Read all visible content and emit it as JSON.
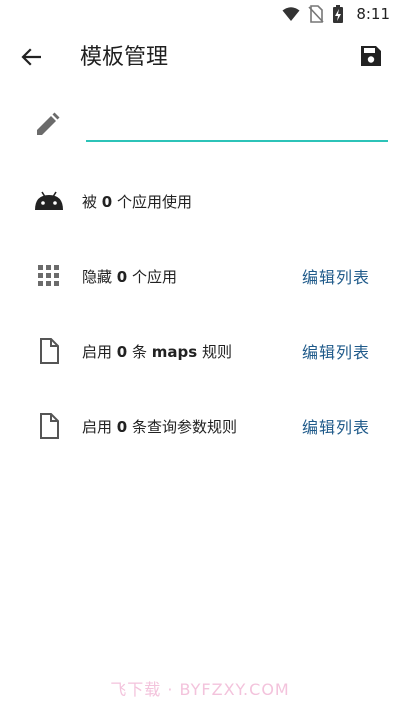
{
  "status_bar": {
    "time": "8:11",
    "icons": [
      "wifi-icon",
      "no-sim-icon",
      "battery-charging-icon"
    ]
  },
  "app_bar": {
    "title": "模板管理",
    "back_icon": "arrow-back-icon",
    "save_icon": "save-icon"
  },
  "name_field": {
    "value": "",
    "placeholder": "",
    "icon": "pencil-icon"
  },
  "rows": [
    {
      "icon": "android-icon",
      "prefix": "被 ",
      "count": "0",
      "suffix": " 个应用使用",
      "action": ""
    },
    {
      "icon": "grid-apps-icon",
      "prefix": "隐藏 ",
      "count": "0",
      "suffix": " 个应用",
      "action": "编辑列表"
    },
    {
      "icon": "document-icon",
      "prefix": "启用 ",
      "count": "0",
      "mid": " 条 ",
      "bold_word": "maps",
      "suffix": " 规则",
      "action": "编辑列表"
    },
    {
      "icon": "document-icon",
      "prefix": "启用 ",
      "count": "0",
      "suffix": " 条查询参数规则",
      "action": "编辑列表"
    }
  ],
  "watermark": "飞下载 · BYFZXY.COM",
  "colors": {
    "accent": "#2cc3b8",
    "action_text": "#1f5a8a",
    "icon_gray": "#6b6b6b"
  }
}
